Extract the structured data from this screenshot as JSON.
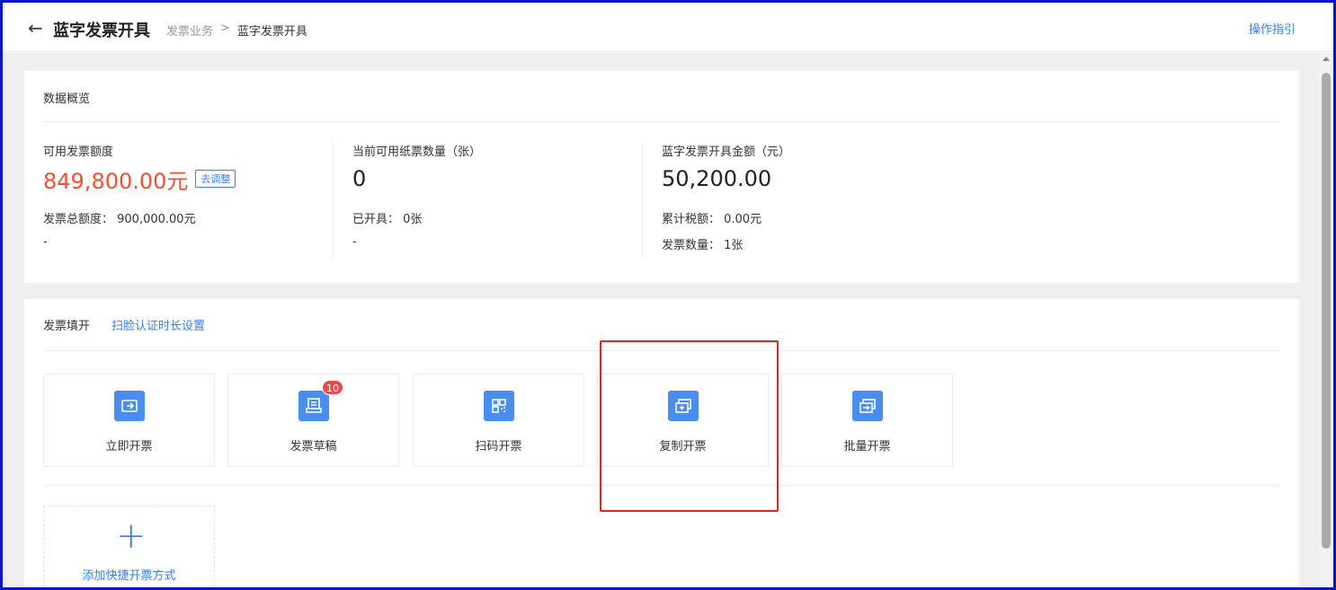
{
  "header": {
    "back_icon": "arrow-left-icon",
    "title": "蓝字发票开具",
    "breadcrumb": [
      "发票业务",
      "蓝字发票开具"
    ],
    "breadcrumb_sep": ">",
    "guide_link": "操作指引"
  },
  "overview": {
    "title": "数据概览",
    "stats": [
      {
        "label": "可用发票额度",
        "value": "849,800.00元",
        "action": "去调整",
        "sub1": "发票总额度： 900,000.00元",
        "sub2": "-"
      },
      {
        "label": "当前可用纸票数量（张）",
        "value": "0",
        "sub1": "已开具： 0张",
        "sub2": "-"
      },
      {
        "label": "蓝字发票开具金额（元）",
        "value": "50,200.00",
        "sub1": "累计税额： 0.00元",
        "sub2": "发票数量： 1张"
      }
    ],
    "accent_color": "#f05033"
  },
  "fill": {
    "title": "发票填开",
    "settings_link": "扫脸认证时长设置",
    "tiles": [
      {
        "label": "立即开票",
        "icon": "ticket-arrow-icon"
      },
      {
        "label": "发票草稿",
        "icon": "draft-icon",
        "badge": "10"
      },
      {
        "label": "扫码开票",
        "icon": "qrcode-icon"
      },
      {
        "label": "复制开票",
        "icon": "copy-ticket-icon"
      },
      {
        "label": "批量开票",
        "icon": "batch-ticket-icon"
      }
    ],
    "add_label": "添加快捷开票方式",
    "add_icon": "plus-icon",
    "highlighted_tile": "复制开票"
  },
  "colors": {
    "brand": "#3b7ee6",
    "icon_bg": "#4a8df0",
    "highlight": "#e8231a",
    "frame": "#0a14c8"
  }
}
